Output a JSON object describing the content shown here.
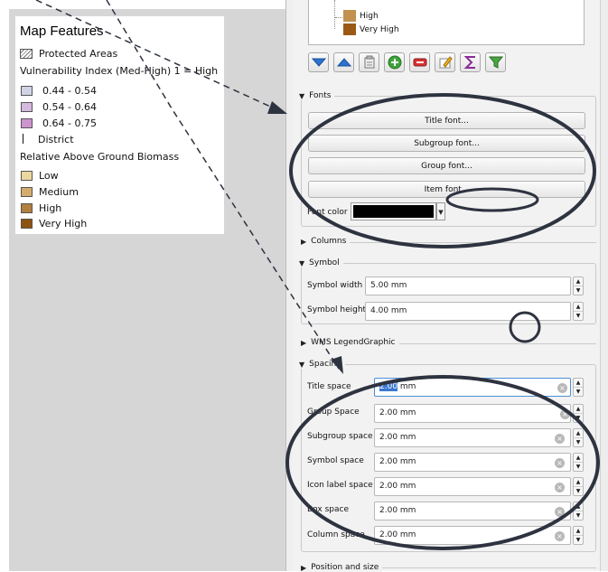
{
  "legend": {
    "title": "Map Features",
    "protected_label": "Protected Areas",
    "vuln_title": "Vulnerability Index (Med-High) 1 = High",
    "vuln_items": [
      {
        "label": "0.44 - 0.54",
        "color": "#d1d3e6"
      },
      {
        "label": "0.54 - 0.64",
        "color": "#d6b9de"
      },
      {
        "label": "0.64 - 0.75",
        "color": "#cc94cf"
      }
    ],
    "district_label": "District",
    "biomass_title": "Relative Above Ground Biomass",
    "biomass_items": [
      {
        "label": "Low",
        "color": "#ecd6a0"
      },
      {
        "label": "Medium",
        "color": "#d4ad6e"
      },
      {
        "label": "High",
        "color": "#b17f3e"
      },
      {
        "label": "Very High",
        "color": "#8e5210"
      }
    ]
  },
  "panel": {
    "list_items": [
      {
        "label": "High",
        "color": "#c0914f"
      },
      {
        "label": "Very High",
        "color": "#9a5a16"
      }
    ],
    "toolbar_icons": [
      "move-down-icon",
      "move-up-icon",
      "edit-group-icon",
      "add-icon",
      "remove-icon",
      "edit-icon",
      "sigma-icon",
      "filter-icon"
    ],
    "fonts": {
      "header": "Fonts",
      "title_font": "Title font...",
      "subgroup_font": "Subgroup font...",
      "group_font": "Group font...",
      "item_font": "Item font...",
      "font_color_label": "Font color",
      "font_color": "#000000"
    },
    "columns_header": "Columns",
    "symbol": {
      "header": "Symbol",
      "width_label": "Symbol width",
      "width_value": "5.00 mm",
      "height_label": "Symbol height",
      "height_value": "4.00 mm"
    },
    "wms_header": "WMS LegendGraphic",
    "spacing": {
      "header": "Spacing",
      "title_space_label": "Title space",
      "title_space_selected": "2.00",
      "title_space_unit": " mm",
      "rows": [
        {
          "label": "Group Space",
          "value": "2.00 mm"
        },
        {
          "label": "Subgroup space",
          "value": "2.00 mm"
        },
        {
          "label": "Symbol space",
          "value": "2.00 mm"
        },
        {
          "label": "Icon label space",
          "value": "2.00 mm"
        },
        {
          "label": "Box space",
          "value": "2.00 mm"
        },
        {
          "label": "Column space",
          "value": "2.00 mm"
        }
      ]
    },
    "position_header": "Position and size"
  },
  "annotation_color": "#2e3340"
}
